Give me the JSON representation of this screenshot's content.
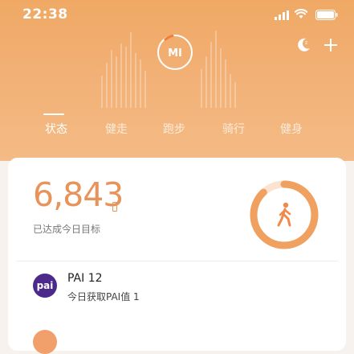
{
  "status_bar": {
    "time": "22:38",
    "icons": [
      "signal-icon",
      "wifi-icon",
      "battery-icon"
    ]
  },
  "header": {
    "logo_text": "MI",
    "actions": [
      "moon-icon",
      "plus-icon"
    ],
    "tabs": [
      {
        "label": "状态",
        "active": true
      },
      {
        "label": "健走",
        "active": false
      },
      {
        "label": "跑步",
        "active": false
      },
      {
        "label": "骑行",
        "active": false
      },
      {
        "label": "健身",
        "active": false
      }
    ]
  },
  "summary_card": {
    "steps": "6,843",
    "goal_label": "已达成今日目标",
    "progress_fraction": 0.88
  },
  "pai": {
    "badge": "pai",
    "title": "PAI 12",
    "subtitle": "今日获取PAI值 1"
  },
  "colors": {
    "header_top": "#f0a965",
    "header_bottom": "#f4bb86",
    "accent": "#e8935a",
    "pai_badge": "#4b2a8c",
    "card_bg": "#ffffff"
  }
}
